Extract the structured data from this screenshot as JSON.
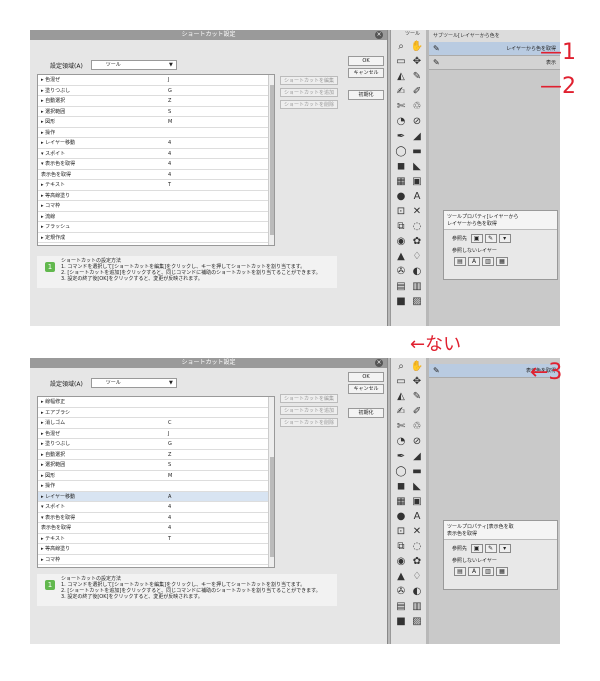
{
  "dialog": {
    "title": "ショートカット設定",
    "close_icon": "close-icon",
    "setting_label": "設定領域(A)",
    "setting_value": "ツール",
    "ok": "OK",
    "cancel": "キャンセル",
    "reset": "初期化",
    "edit_shortcut": "ショートカットを編集",
    "add_shortcut": "ショートカットを追加",
    "delete_shortcut": "ショートカットを削除",
    "help": {
      "title": "ショートカットの設定方法",
      "line1": "1. コマンドを選択して[ショートカットを編集]をクリックし、キーを押してショートカットを割り当てます。",
      "line2": "2. [ショートカットを追加]をクリックすると、同じコマンドに補助のショートカットを割り当てることができます。",
      "line3": "3. 設定の終了後[OK]をクリックすると、変更が反映されます。"
    }
  },
  "top_list": [
    {
      "name": "▸ 色混ぜ",
      "key": "J"
    },
    {
      "name": "▸ 塗りつぶし",
      "key": "G"
    },
    {
      "name": "▸ 自動選択",
      "key": "Z"
    },
    {
      "name": "▸ 選択範囲",
      "key": "S"
    },
    {
      "name": "▸ 図形",
      "key": "M"
    },
    {
      "name": "▸ 操作",
      "key": ""
    },
    {
      "name": "▸ レイヤー移動",
      "key": "4"
    },
    {
      "name": "▾ スポイト",
      "key": "4"
    },
    {
      "name": "  ▾ 表示色を取得",
      "key": "4"
    },
    {
      "name": "    表示色を取得",
      "key": "4"
    },
    {
      "name": "▸ テキスト",
      "key": "T"
    },
    {
      "name": "▸ 等高線塗り",
      "key": ""
    },
    {
      "name": "▸ コマ枠",
      "key": ""
    },
    {
      "name": "▸ 流線",
      "key": ""
    },
    {
      "name": "▸ フラッシュ",
      "key": ""
    },
    {
      "name": "▸ 定規作成",
      "key": ""
    }
  ],
  "bottom_list": [
    {
      "name": "▸ 線幅修正",
      "key": ""
    },
    {
      "name": "▸ エアブラシ",
      "key": ""
    },
    {
      "name": "▸ 消しゴム",
      "key": "C"
    },
    {
      "name": "▸ 色混ぜ",
      "key": "J"
    },
    {
      "name": "▸ 塗りつぶし",
      "key": "G"
    },
    {
      "name": "▸ 自動選択",
      "key": "Z"
    },
    {
      "name": "▸ 選択範囲",
      "key": "S"
    },
    {
      "name": "▸ 図形",
      "key": "M"
    },
    {
      "name": "▸ 操作",
      "key": ""
    },
    {
      "name": "▸ レイヤー移動",
      "key": "A"
    },
    {
      "name": "▾ スポイト",
      "key": "4"
    },
    {
      "name": "  ▾ 表示色を取得",
      "key": "4"
    },
    {
      "name": "    表示色を取得",
      "key": "4"
    },
    {
      "name": "▸ テキスト",
      "key": "T"
    },
    {
      "name": "▸ 等高線塗り",
      "key": ""
    },
    {
      "name": "▸ コマ枠",
      "key": ""
    }
  ],
  "top_panel": {
    "tool_tab": "ツール",
    "sub_head": "サブツール[レイヤーから色を",
    "item1": "レイヤーから色を取得",
    "item2": "表示",
    "prop_title": "ツールプロパティ[レイヤーから",
    "prop_sub": "レイヤーから色を取得",
    "ref_label": "参照先",
    "ref_none": "参照しないレイヤー"
  },
  "bottom_panel": {
    "item1": "表示色を取得",
    "prop_title": "ツールプロパティ[表示色を取",
    "prop_sub": "表示色を取得",
    "ref_label": "参照先",
    "ref_none": "参照しないレイヤー"
  },
  "annotations": {
    "a1": "—1",
    "a2": "—2",
    "a3": "←3",
    "nai": "←ない"
  },
  "colors": {
    "annotation": "#e0202f",
    "help_icon": "#62b84e",
    "selected_row": "#d8e4f2"
  }
}
